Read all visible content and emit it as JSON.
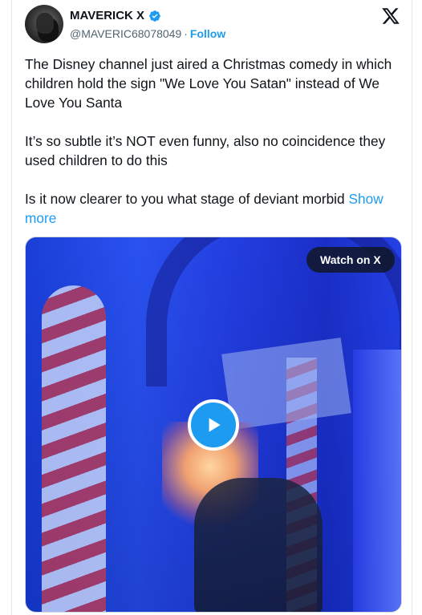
{
  "author": {
    "display_name": "MAVERICK X",
    "handle": "@MAVERIC68078049",
    "separator": "·",
    "follow_label": "Follow",
    "verified_icon": "verified-badge-icon",
    "avatar_icon": "avatar"
  },
  "logo": {
    "icon": "x-logo-icon"
  },
  "tweet": {
    "paragraphs": [
      "The Disney channel just aired a Christmas comedy in which children hold the sign \"We Love You Satan\" instead of We Love You Santa",
      "It’s so subtle it’s NOT even funny, also no coincidence they used children to do this",
      "Is it now clearer to you what stage of deviant morbid"
    ],
    "show_more_label": "Show more"
  },
  "media": {
    "watch_label": "Watch on X",
    "play_icon": "play-icon"
  },
  "colors": {
    "accent": "#1d9bf0",
    "text": "#0f1419",
    "muted": "#536471"
  }
}
